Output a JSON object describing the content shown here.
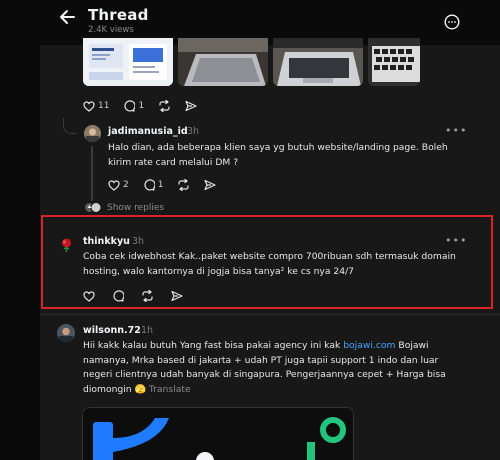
{
  "header": {
    "title": "Thread",
    "views": "2.4K views",
    "back_icon": "arrow-left-icon",
    "more_icon": "more-circle-icon"
  },
  "post_actions": {
    "likes": "11",
    "comments": "1"
  },
  "reply1": {
    "username": "jadimanusia_id",
    "time": "3h",
    "text_lines": [
      "Halo dian, ada beberapa klien saya yg butuh website/landing page. Boleh",
      "kirim rate card melalui DM ?"
    ],
    "likes": "2",
    "comments": "1",
    "show_replies": "Show replies"
  },
  "reply2": {
    "username": "thinkkyu",
    "time": "3h",
    "text_lines": [
      "Coba cek idwebhost Kak..paket website compro 700ribuan sdh termasuk domain",
      "hosting, walo kantornya di jogja bisa tanya² ke cs nya 24/7"
    ]
  },
  "reply3": {
    "username": "wilsonn.72",
    "time": "1h",
    "line1_a": "Hii kakk kalau butuh Yang fast bisa pakai agency ini kak ",
    "line1_link": "bojawi.com",
    "line1_b": " Bojawi",
    "line2": "namanya, Mrka based di jakarta + udah PT juga tapii support 1 indo dan luar",
    "line3": "negeri clientnya udah banyak di singapura. Pengerjaannya cepet + Harga bisa",
    "line4": "diomongin 🫣 ",
    "translate": "Translate"
  },
  "colors": {
    "background": "#0a0a0a",
    "panel": "#181818",
    "highlight": "#d6242a",
    "link": "#4aa3ff",
    "logo_blue": "#1f7bff",
    "logo_green": "#23c47e"
  }
}
